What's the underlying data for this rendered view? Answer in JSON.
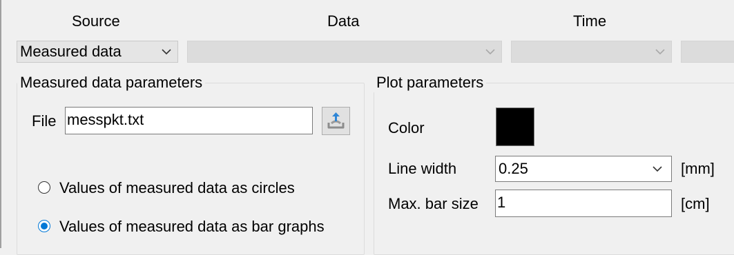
{
  "headers": {
    "source": "Source",
    "data": "Data",
    "time": "Time"
  },
  "source_select": {
    "value": "Measured data"
  },
  "data_select": {
    "value": ""
  },
  "time_select": {
    "value": ""
  },
  "measured_group": {
    "title": "Measured data parameters",
    "file_label": "File",
    "file_value": "messpkt.txt",
    "radio_circles": "Values of measured data as circles",
    "radio_bars": "Values of measured data as bar graphs",
    "selected": "bars"
  },
  "plot_group": {
    "title": "Plot parameters",
    "color_label": "Color",
    "color_value": "#000000",
    "line_width_label": "Line width",
    "line_width_value": "0.25",
    "line_width_unit": "[mm]",
    "max_bar_label": "Max. bar size",
    "max_bar_value": "1",
    "max_bar_unit": "[cm]"
  },
  "icons": {
    "chevron": "chevron-down-icon",
    "open_file": "upload-file-icon"
  }
}
